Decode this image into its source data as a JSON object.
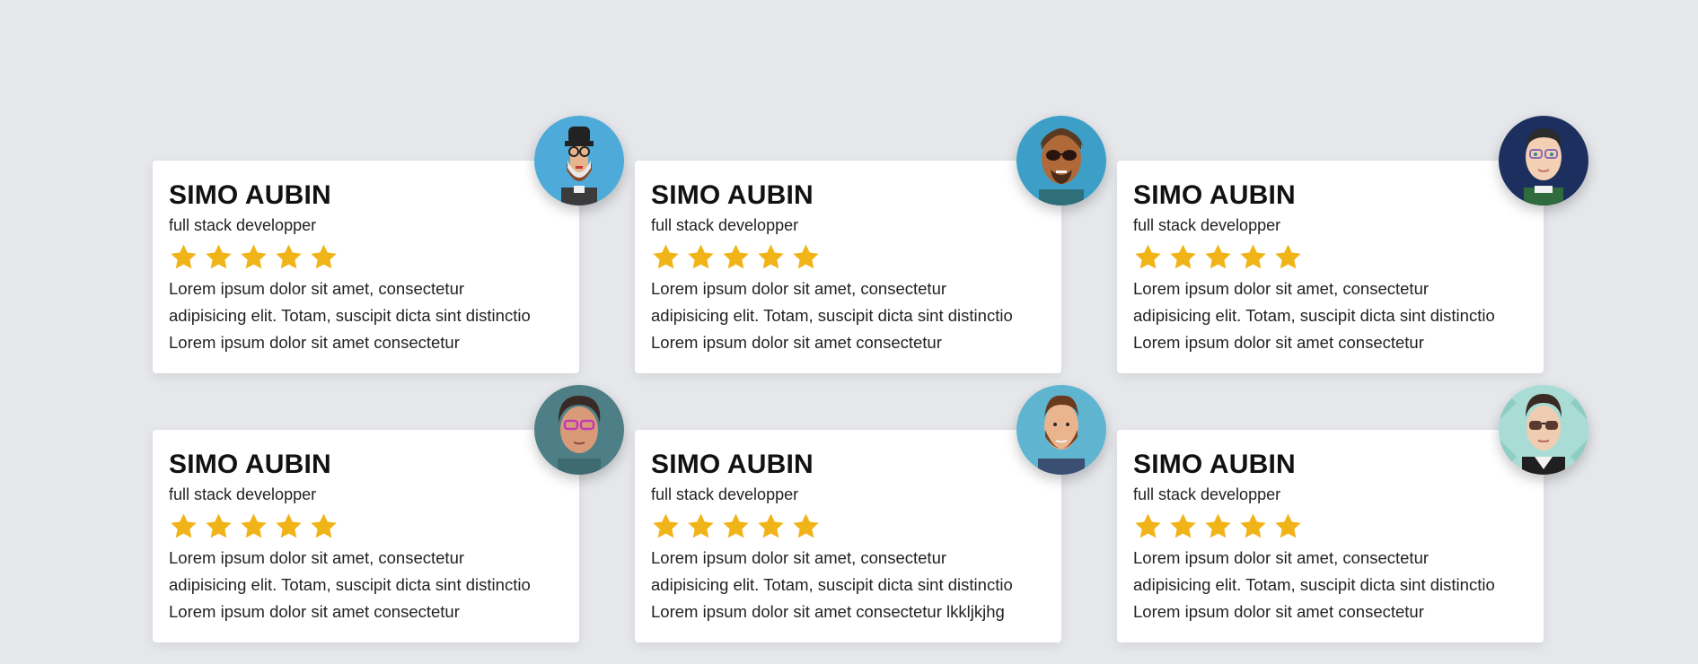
{
  "colors": {
    "background": "#e5e7eb",
    "card": "#ffffff",
    "star": "#f0b418",
    "text": "#222222"
  },
  "cards": [
    {
      "name": "SIMO AUBIN",
      "role": "full stack developper",
      "rating": 5,
      "avatar": "avatar-hipster-beard-glasses-icon",
      "lines": [
        "Lorem ipsum dolor sit amet, consectetur",
        "adipisicing elit. Totam, suscipit dicta sint distinctio",
        "Lorem ipsum dolor sit amet consectetur"
      ]
    },
    {
      "name": "SIMO AUBIN",
      "role": "full stack developper",
      "rating": 5,
      "avatar": "avatar-sunglasses-beard-icon",
      "lines": [
        "Lorem ipsum dolor sit amet, consectetur",
        "adipisicing elit. Totam, suscipit dicta sint distinctio",
        "Lorem ipsum dolor sit amet consectetur"
      ]
    },
    {
      "name": "SIMO AUBIN",
      "role": "full stack developper",
      "rating": 5,
      "avatar": "avatar-glasses-man-icon",
      "lines": [
        "Lorem ipsum dolor sit amet, consectetur",
        "adipisicing elit. Totam, suscipit dicta sint distinctio",
        "Lorem ipsum dolor sit amet consectetur"
      ]
    },
    {
      "name": "SIMO AUBIN",
      "role": "full stack developper",
      "rating": 5,
      "avatar": "avatar-pink-glasses-icon",
      "lines": [
        "Lorem ipsum dolor sit amet, consectetur",
        "adipisicing elit. Totam, suscipit dicta sint distinctio",
        "Lorem ipsum dolor sit amet consectetur"
      ]
    },
    {
      "name": "SIMO AUBIN",
      "role": "full stack developper",
      "rating": 5,
      "avatar": "avatar-bearded-man-icon",
      "lines": [
        "Lorem ipsum dolor sit amet, consectetur",
        "adipisicing elit. Totam, suscipit dicta sint distinctio",
        "Lorem ipsum dolor sit amet consectetur lkkljkjhg"
      ]
    },
    {
      "name": "SIMO AUBIN",
      "role": "full stack developper",
      "rating": 5,
      "avatar": "avatar-aviator-glasses-icon",
      "lines": [
        "Lorem ipsum dolor sit amet, consectetur",
        "adipisicing elit. Totam, suscipit dicta sint distinctio",
        "Lorem ipsum dolor sit amet consectetur"
      ]
    }
  ]
}
